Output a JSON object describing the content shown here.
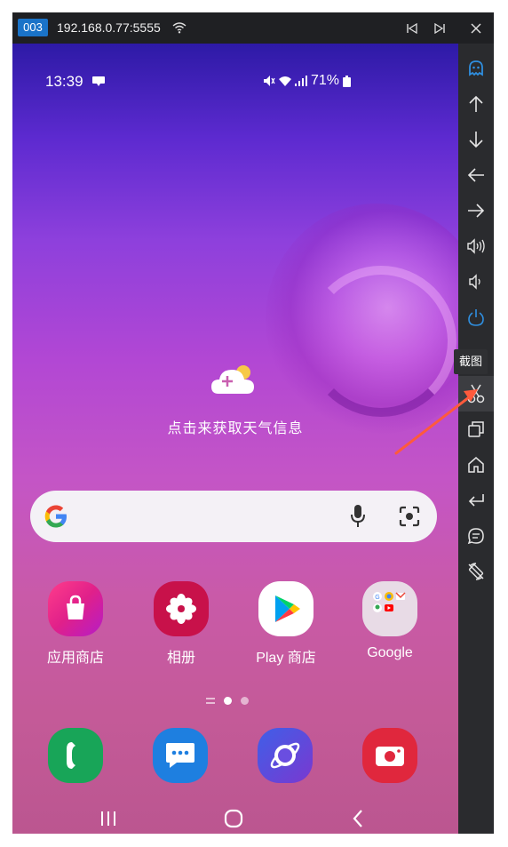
{
  "titlebar": {
    "badge": "003",
    "ip": "192.168.0.77:5555",
    "buttons": [
      "prev-icon",
      "next-icon",
      "close-icon"
    ]
  },
  "phone": {
    "status": {
      "time": "13:39",
      "battery": "71%"
    },
    "weather": {
      "text": "点击来获取天气信息",
      "icon": "weather-add-icon"
    },
    "search": {
      "icons": [
        "google-g-icon",
        "mic-icon",
        "lens-icon"
      ]
    },
    "apps": [
      {
        "label": "应用商店",
        "icon": "galaxy-store-icon",
        "color": "#f0308a"
      },
      {
        "label": "相册",
        "icon": "gallery-icon",
        "color": "#c8114a"
      },
      {
        "label": "Play 商店",
        "icon": "play-store-icon",
        "color": "#ffffff"
      },
      {
        "label": "Google",
        "icon": "google-folder-icon",
        "color": "#e8dbe6"
      }
    ],
    "dock": [
      {
        "icon": "phone-icon",
        "color": "#18a558"
      },
      {
        "icon": "messages-icon",
        "color": "#1e7fe0"
      },
      {
        "icon": "internet-icon",
        "color": "#5b3fd6"
      },
      {
        "icon": "camera-icon",
        "color": "#e0273d"
      }
    ]
  },
  "sidebar": {
    "tooltip": "截图",
    "buttons": [
      "ghost-icon",
      "arrow-up-icon",
      "arrow-down-icon",
      "arrow-left-icon",
      "arrow-right-icon",
      "volume-up-icon",
      "volume-down-icon",
      "power-icon",
      "screenshot-icon",
      "recents-icon",
      "home-icon",
      "back-icon",
      "chat-icon",
      "rotate-icon"
    ]
  }
}
